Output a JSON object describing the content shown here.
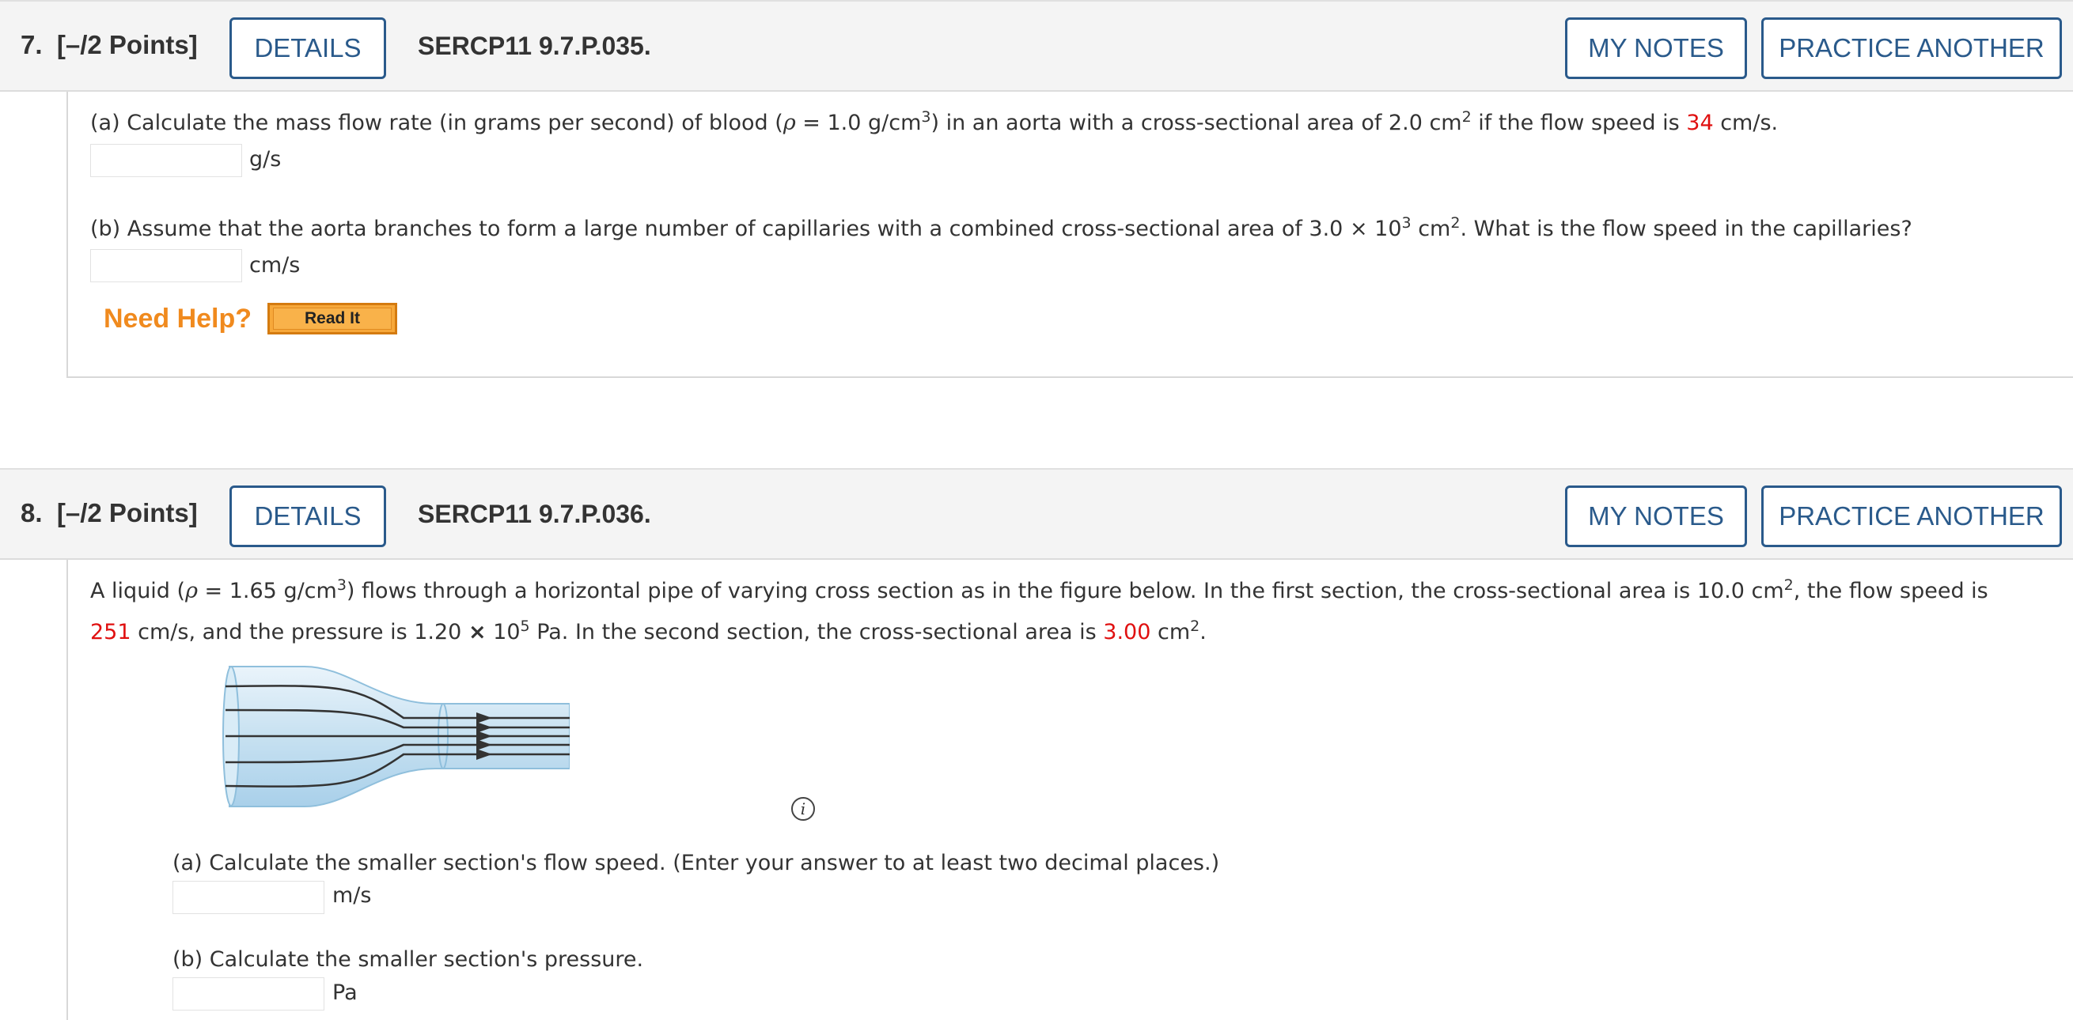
{
  "q7": {
    "number": "7.",
    "points": "[–/2 Points]",
    "details_label": "DETAILS",
    "code": "SERCP11 9.7.P.035.",
    "mynotes_label": "MY NOTES",
    "practice_label": "PRACTICE ANOTHER",
    "part_a": {
      "t1": "(a) Calculate the mass flow rate (in grams per second) of blood (",
      "rho": "ρ",
      "t2": " = 1.0 g/cm",
      "sup1": "3",
      "t3": ") in an aorta with a cross-sectional area of 2.0 cm",
      "sup2": "2",
      "t4": " if the flow speed is ",
      "val": "34",
      "t5": " cm/s.",
      "unit": "g/s"
    },
    "part_b": {
      "t1": "(b) Assume that the aorta branches to form a large number of capillaries with a combined cross-sectional area of 3.0 × 10",
      "sup1": "3",
      "t2": " cm",
      "sup2": "2",
      "t3": ". What is the flow speed in the capillaries?",
      "unit": "cm/s"
    },
    "need_help": "Need Help?",
    "read_it": "Read It"
  },
  "q8": {
    "number": "8.",
    "points": "[–/2 Points]",
    "details_label": "DETAILS",
    "code": "SERCP11 9.7.P.036.",
    "mynotes_label": "MY NOTES",
    "practice_label": "PRACTICE ANOTHER",
    "intro": {
      "t1": "A liquid (",
      "rho": "ρ",
      "t2": " = 1.65 g/cm",
      "sup1": "3",
      "t3": ") flows through a horizontal pipe of varying cross section as in the figure below. In the first section, the cross-sectional area is 10.0 cm",
      "sup2": "2",
      "t4": ", the flow speed is",
      "val1": "251",
      "t5": " cm/s, and the pressure is 1.20 ",
      "times": "×",
      "t6": " 10",
      "sup3": "5",
      "t7": " Pa. In the second section, the cross-sectional area is ",
      "val2": "3.00",
      "t8": " cm",
      "sup4": "2",
      "t9": "."
    },
    "info_symbol": "i",
    "part_a": {
      "text": "(a) Calculate the smaller section's flow speed. (Enter your answer to at least two decimal places.)",
      "unit": "m/s"
    },
    "part_b": {
      "text": "(b) Calculate the smaller section's pressure.",
      "unit": "Pa"
    }
  },
  "colors": {
    "accent": "#2a5a8b",
    "highlight": "#e01010",
    "help": "#f08a1e"
  }
}
